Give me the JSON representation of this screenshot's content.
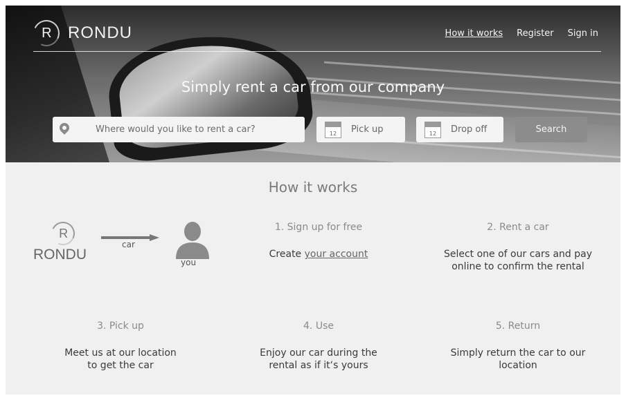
{
  "header": {
    "brand_letter": "R",
    "brand_name": "RONDU",
    "nav": {
      "how_it_works": "How it works",
      "register": "Register",
      "sign_in": "Sign in"
    },
    "headline": "Simply rent a car from our company"
  },
  "search": {
    "placeholder": "Where would you like to rent a car?",
    "pickup_label": "Pick up",
    "dropoff_label": "Drop off",
    "calendar_day": "12",
    "button_label": "Search"
  },
  "how": {
    "title": "How it works",
    "illustration": {
      "brand_letter": "R",
      "brand_name": "RONDU",
      "car_label": "car",
      "you_label": "you"
    },
    "steps": [
      {
        "title": "1. Sign up for free",
        "desc_prefix": "Create ",
        "desc_link": "your account"
      },
      {
        "title": "2. Rent a car",
        "desc_line1": "Select one of our cars and pay",
        "desc_line2": "online to confirm the rental"
      },
      {
        "title": "3. Pick up",
        "desc_line1": "Meet us at our location",
        "desc_line2": "to get the car"
      },
      {
        "title": "4. Use",
        "desc_line1": "Enjoy our car during the",
        "desc_line2": "rental as if it‘s yours"
      },
      {
        "title": "5. Return",
        "desc_line1": "Simply return the car to our",
        "desc_line2": "location"
      }
    ]
  }
}
